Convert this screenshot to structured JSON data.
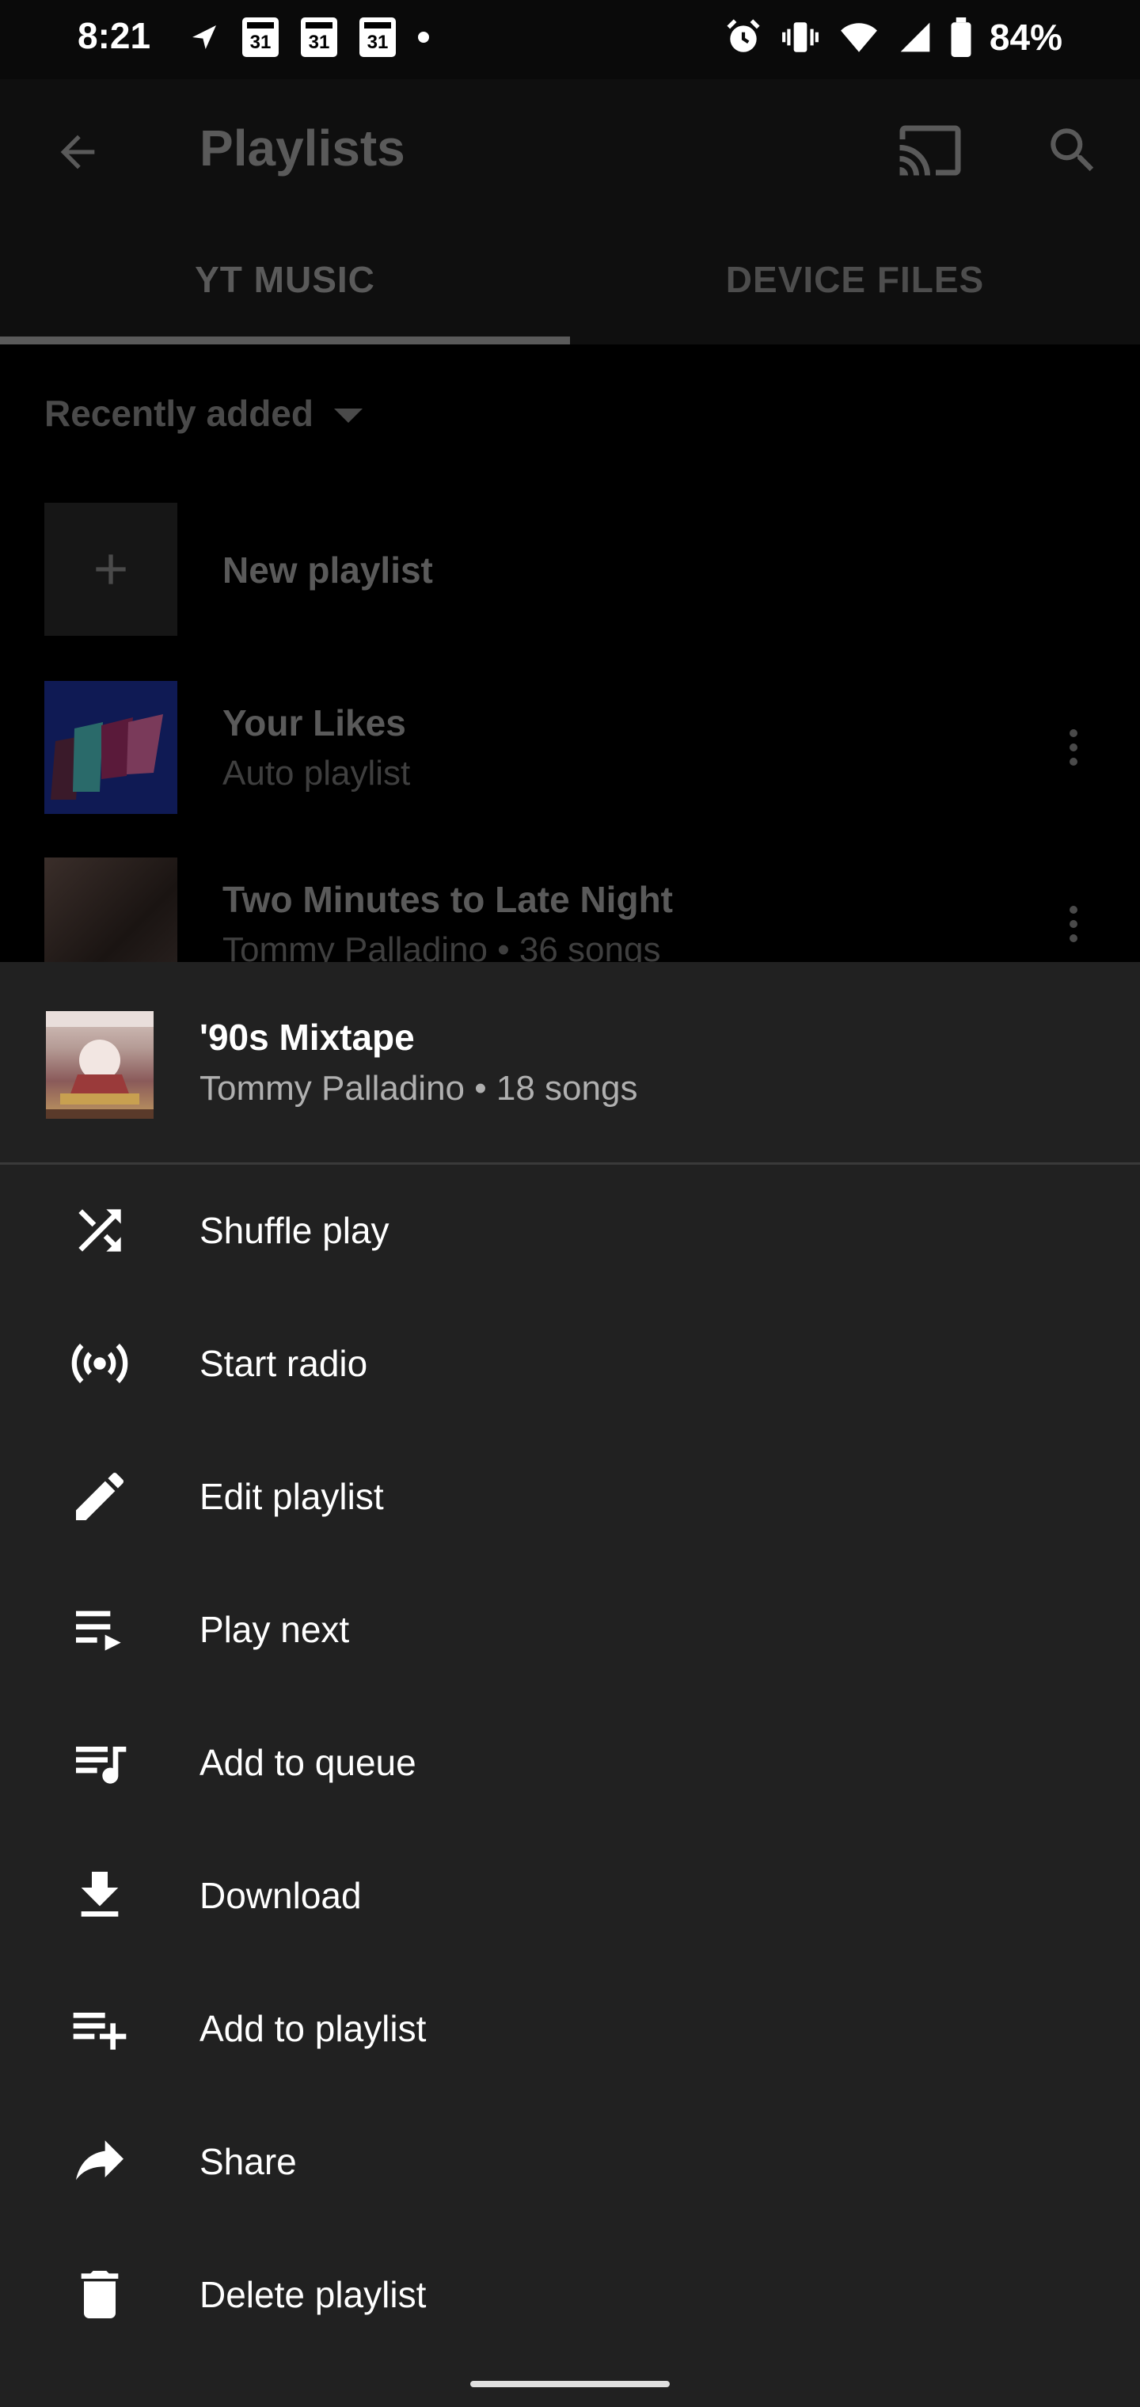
{
  "status_bar": {
    "time": "8:21",
    "calendar_day": "31",
    "battery": "84%"
  },
  "app_bar": {
    "title": "Playlists",
    "icons": [
      "back-arrow-icon",
      "cast-icon",
      "search-icon"
    ]
  },
  "tabs": [
    {
      "label": "YT MUSIC",
      "selected": true
    },
    {
      "label": "DEVICE FILES",
      "selected": false
    }
  ],
  "sort": {
    "label": "Recently added"
  },
  "playlists": [
    {
      "title": "New playlist",
      "subtitle": ""
    },
    {
      "title": "Your Likes",
      "subtitle": "Auto playlist"
    },
    {
      "title": "Two Minutes to Late Night",
      "subtitle": "Tommy Palladino • 36 songs"
    }
  ],
  "sheet": {
    "title": "'90s Mixtape",
    "subtitle": "Tommy Palladino • 18 songs",
    "menu": [
      {
        "label": "Shuffle play",
        "icon": "shuffle-icon"
      },
      {
        "label": "Start radio",
        "icon": "radio-icon"
      },
      {
        "label": "Edit playlist",
        "icon": "pencil-icon"
      },
      {
        "label": "Play next",
        "icon": "play-next-icon"
      },
      {
        "label": "Add to queue",
        "icon": "add-to-queue-icon"
      },
      {
        "label": "Download",
        "icon": "download-icon"
      },
      {
        "label": "Add to playlist",
        "icon": "add-to-playlist-icon"
      },
      {
        "label": "Share",
        "icon": "share-icon"
      },
      {
        "label": "Delete playlist",
        "icon": "trash-icon"
      }
    ]
  },
  "colors": {
    "sheet_background": "#212121",
    "scrim_background": "#000000",
    "text_primary": "#ffffff",
    "text_secondary": "#b0b0b0"
  }
}
